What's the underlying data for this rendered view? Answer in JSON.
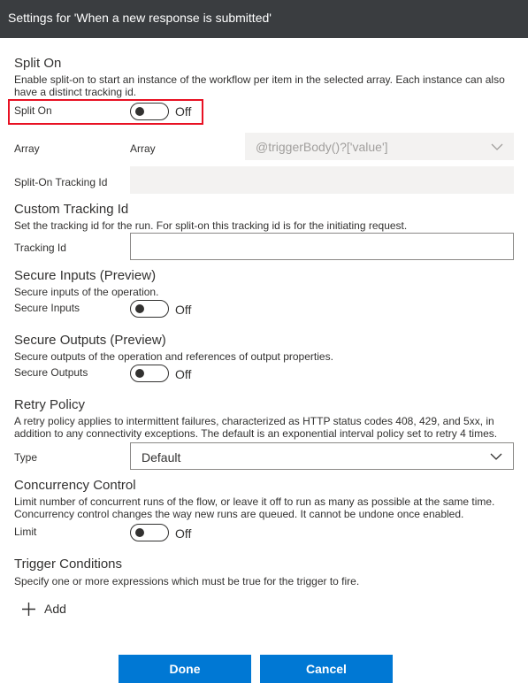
{
  "header": {
    "title": "Settings for 'When a new response is submitted'"
  },
  "split_on": {
    "title": "Split On",
    "description": "Enable split-on to start an instance of the workflow per item in the selected array. Each instance can also have a distinct tracking id.",
    "toggle_label": "Split On",
    "toggle_state": "Off",
    "array_label": "Array",
    "array_inner_label": "Array",
    "array_value": "@triggerBody()?['value']",
    "tracking_label": "Split-On Tracking Id"
  },
  "custom_tracking": {
    "title": "Custom Tracking Id",
    "description": "Set the tracking id for the run. For split-on this tracking id is for the initiating request.",
    "field_label": "Tracking Id",
    "value": ""
  },
  "secure_inputs": {
    "title": "Secure Inputs (Preview)",
    "description": "Secure inputs of the operation.",
    "toggle_label": "Secure Inputs",
    "toggle_state": "Off"
  },
  "secure_outputs": {
    "title": "Secure Outputs (Preview)",
    "description": "Secure outputs of the operation and references of output properties.",
    "toggle_label": "Secure Outputs",
    "toggle_state": "Off"
  },
  "retry_policy": {
    "title": "Retry Policy",
    "description": "A retry policy applies to intermittent failures, characterized as HTTP status codes 408, 429, and 5xx, in addition to any connectivity exceptions. The default is an exponential interval policy set to retry 4 times.",
    "type_label": "Type",
    "type_value": "Default"
  },
  "concurrency": {
    "title": "Concurrency Control",
    "description": "Limit number of concurrent runs of the flow, or leave it off to run as many as possible at the same time. Concurrency control changes the way new runs are queued. It cannot be undone once enabled.",
    "toggle_label": "Limit",
    "toggle_state": "Off"
  },
  "trigger_conditions": {
    "title": "Trigger Conditions",
    "description": "Specify one or more expressions which must be true for the trigger to fire.",
    "add_label": "Add"
  },
  "footer": {
    "done_label": "Done",
    "cancel_label": "Cancel"
  },
  "colors": {
    "header_bg": "#3a3d40",
    "primary": "#0078d4",
    "highlight": "#e81123",
    "disabled_bg": "#f3f2f1"
  },
  "icons": {
    "chevron": "chevron-down-icon",
    "add": "plus-icon"
  }
}
